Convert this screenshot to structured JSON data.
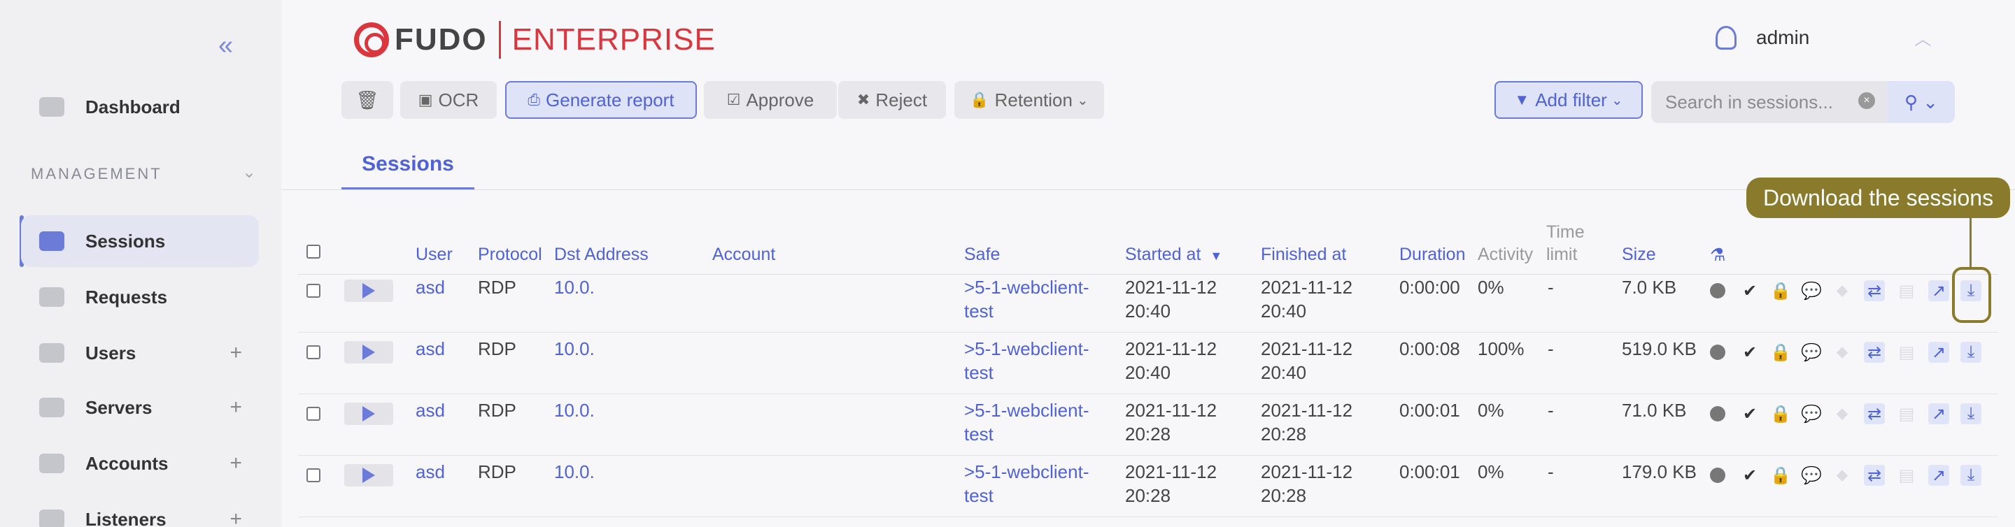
{
  "brand": {
    "left": "FUDO",
    "right": "ENTERPRISE"
  },
  "sidebar": {
    "collapse_glyph": "«",
    "dashboard": "Dashboard",
    "section": "MANAGEMENT",
    "items": [
      {
        "label": "Sessions",
        "plus": ""
      },
      {
        "label": "Requests",
        "plus": ""
      },
      {
        "label": "Users",
        "plus": "+"
      },
      {
        "label": "Servers",
        "plus": "+"
      },
      {
        "label": "Accounts",
        "plus": "+"
      },
      {
        "label": "Listeners",
        "plus": "+"
      }
    ]
  },
  "user": {
    "name": "admin"
  },
  "toolbar": {
    "ocr": "OCR",
    "generate_report": "Generate report",
    "approve": "Approve",
    "reject": "Reject",
    "retention": "Retention",
    "add_filter": "Add filter",
    "search_placeholder": "Search in sessions..."
  },
  "tabs": {
    "sessions": "Sessions"
  },
  "table": {
    "headers": {
      "user": "User",
      "protocol": "Protocol",
      "dst_address": "Dst Address",
      "account": "Account",
      "safe": "Safe",
      "started_at": "Started at",
      "finished_at": "Finished at",
      "duration": "Duration",
      "activity": "Activity",
      "time_limit_1": "Time",
      "time_limit_2": "limit",
      "size": "Size"
    },
    "rows": [
      {
        "user": "asd",
        "protocol": "RDP",
        "dst": "10.0.",
        "safe1": ">5-1-webclient-",
        "safe2": "test",
        "start1": "2021-11-12",
        "start2": "20:40",
        "fin1": "2021-11-12",
        "fin2": "20:40",
        "duration": "0:00:00",
        "activity": "0%",
        "time_limit": "-",
        "size": "7.0 KB"
      },
      {
        "user": "asd",
        "protocol": "RDP",
        "dst": "10.0.",
        "safe1": ">5-1-webclient-",
        "safe2": "test",
        "start1": "2021-11-12",
        "start2": "20:40",
        "fin1": "2021-11-12",
        "fin2": "20:40",
        "duration": "0:00:08",
        "activity": "100%",
        "time_limit": "-",
        "size": "519.0 KB"
      },
      {
        "user": "asd",
        "protocol": "RDP",
        "dst": "10.0.",
        "safe1": ">5-1-webclient-",
        "safe2": "test",
        "start1": "2021-11-12",
        "start2": "20:28",
        "fin1": "2021-11-12",
        "fin2": "20:28",
        "duration": "0:00:01",
        "activity": "0%",
        "time_limit": "-",
        "size": "71.0 KB"
      },
      {
        "user": "asd",
        "protocol": "RDP",
        "dst": "10.0.",
        "safe1": ">5-1-webclient-",
        "safe2": "test",
        "start1": "2021-11-12",
        "start2": "20:28",
        "fin1": "2021-11-12",
        "fin2": "20:28",
        "duration": "0:00:01",
        "activity": "0%",
        "time_limit": "-",
        "size": "179.0 KB"
      }
    ]
  },
  "callout": "Download the sessions",
  "colors": {
    "accent": "#6c7bd8",
    "brand_red": "#d9363e",
    "callout": "#8a7a2c"
  }
}
